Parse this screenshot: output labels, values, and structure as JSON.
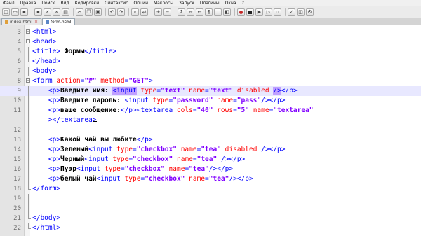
{
  "menu": [
    "Файл",
    "Правка",
    "Поиск",
    "Вид",
    "Кодировки",
    "Синтаксис",
    "Опции",
    "Макросы",
    "Запуск",
    "Плагины",
    "Окна",
    "?"
  ],
  "tabs": [
    {
      "label": "index.html",
      "active": false
    },
    {
      "label": "form.html",
      "active": true
    }
  ],
  "editor": {
    "current_line": 9,
    "lines": [
      {
        "n": "3",
        "fold": "box",
        "tokens": [
          [
            "t",
            "<html>"
          ]
        ]
      },
      {
        "n": "4",
        "fold": "box",
        "tokens": [
          [
            "t",
            "<head>"
          ]
        ]
      },
      {
        "n": "5",
        "fold": "vl",
        "tokens": [
          [
            "t",
            "<title>"
          ],
          [
            "x",
            " Формы"
          ],
          [
            "t",
            "</title>"
          ]
        ]
      },
      {
        "n": "6",
        "fold": "end",
        "tokens": [
          [
            "t",
            "</head>"
          ]
        ]
      },
      {
        "n": "7",
        "fold": "vl",
        "tokens": [
          [
            "t",
            "<body>"
          ]
        ]
      },
      {
        "n": "8",
        "fold": "box",
        "tokens": [
          [
            "t",
            "<form "
          ],
          [
            "a",
            "action"
          ],
          [
            "t",
            "="
          ],
          [
            "v",
            "\"#\""
          ],
          [
            "t",
            " "
          ],
          [
            "a",
            "method"
          ],
          [
            "t",
            "="
          ],
          [
            "v",
            "\"GET\""
          ],
          [
            "t",
            ">"
          ]
        ]
      },
      {
        "n": "9",
        "fold": "vl",
        "tokens": [
          [
            "t",
            "    <p>"
          ],
          [
            "x",
            "Введите имя: "
          ],
          [
            "th",
            "<input"
          ],
          [
            "t",
            " "
          ],
          [
            "a",
            "type"
          ],
          [
            "t",
            "="
          ],
          [
            "v",
            "\"text\""
          ],
          [
            "t",
            " "
          ],
          [
            "a",
            "name"
          ],
          [
            "t",
            "="
          ],
          [
            "v",
            "\"text\""
          ],
          [
            "t",
            " "
          ],
          [
            "a",
            "disabled"
          ],
          [
            "t",
            " "
          ],
          [
            "th",
            "/>"
          ],
          [
            "t",
            "</p>"
          ]
        ]
      },
      {
        "n": "10",
        "fold": "vl",
        "tokens": [
          [
            "t",
            "    <p>"
          ],
          [
            "x",
            "Введите пароль: "
          ],
          [
            "t",
            "<input "
          ],
          [
            "a",
            "type"
          ],
          [
            "t",
            "="
          ],
          [
            "v",
            "\"password\""
          ],
          [
            "t",
            " "
          ],
          [
            "a",
            "name"
          ],
          [
            "t",
            "="
          ],
          [
            "v",
            "\"pass\""
          ],
          [
            "t",
            "/></p>"
          ]
        ]
      },
      {
        "n": "11",
        "fold": "vl",
        "tokens": [
          [
            "t",
            "    <p>"
          ],
          [
            "x",
            "ваше сообщение:"
          ],
          [
            "t",
            "</p><textarea "
          ],
          [
            "a",
            "cols"
          ],
          [
            "t",
            "="
          ],
          [
            "v",
            "\"40\""
          ],
          [
            "t",
            " "
          ],
          [
            "a",
            "rows"
          ],
          [
            "t",
            "="
          ],
          [
            "v",
            "\"5\""
          ],
          [
            "t",
            " "
          ],
          [
            "a",
            "name"
          ],
          [
            "t",
            "="
          ],
          [
            "v",
            "\"textarea\""
          ]
        ]
      },
      {
        "n": "",
        "fold": "vl",
        "tokens": [
          [
            "t",
            "    ></textarea>"
          ]
        ]
      },
      {
        "n": "12",
        "fold": "vl",
        "tokens": []
      },
      {
        "n": "13",
        "fold": "vl",
        "tokens": [
          [
            "t",
            "    <p>"
          ],
          [
            "x",
            "Какой чай вы любите"
          ],
          [
            "t",
            "</p>"
          ]
        ]
      },
      {
        "n": "14",
        "fold": "vl",
        "tokens": [
          [
            "t",
            "    <p>"
          ],
          [
            "x",
            "Зеленый"
          ],
          [
            "t",
            "<input "
          ],
          [
            "a",
            "type"
          ],
          [
            "t",
            "="
          ],
          [
            "v",
            "\"checkbox\""
          ],
          [
            "t",
            " "
          ],
          [
            "a",
            "name"
          ],
          [
            "t",
            "="
          ],
          [
            "v",
            "\"tea\""
          ],
          [
            "t",
            " "
          ],
          [
            "a",
            "disabled"
          ],
          [
            "t",
            " /></p>"
          ]
        ]
      },
      {
        "n": "15",
        "fold": "vl",
        "tokens": [
          [
            "t",
            "    <p>"
          ],
          [
            "x",
            "Черный"
          ],
          [
            "t",
            "<input "
          ],
          [
            "a",
            "type"
          ],
          [
            "t",
            "="
          ],
          [
            "v",
            "\"checkbox\""
          ],
          [
            "t",
            " "
          ],
          [
            "a",
            "name"
          ],
          [
            "t",
            "="
          ],
          [
            "v",
            "\"tea\""
          ],
          [
            "t",
            " /></p>"
          ]
        ]
      },
      {
        "n": "16",
        "fold": "vl",
        "tokens": [
          [
            "t",
            "    <p>"
          ],
          [
            "x",
            "Пуэр"
          ],
          [
            "t",
            "<input "
          ],
          [
            "a",
            "type"
          ],
          [
            "t",
            "="
          ],
          [
            "v",
            "\"checkbox\""
          ],
          [
            "t",
            " "
          ],
          [
            "a",
            "name"
          ],
          [
            "t",
            "="
          ],
          [
            "v",
            "\"tea\""
          ],
          [
            "t",
            "/></p>"
          ]
        ]
      },
      {
        "n": "17",
        "fold": "vl",
        "tokens": [
          [
            "t",
            "    <p>"
          ],
          [
            "x",
            "белый чай"
          ],
          [
            "t",
            "<input "
          ],
          [
            "a",
            "type"
          ],
          [
            "t",
            "="
          ],
          [
            "v",
            "\"checkbox\""
          ],
          [
            "t",
            " "
          ],
          [
            "a",
            "name"
          ],
          [
            "t",
            "="
          ],
          [
            "v",
            "\"tea\""
          ],
          [
            "t",
            "/></p>"
          ]
        ]
      },
      {
        "n": "18",
        "fold": "end",
        "tokens": [
          [
            "t",
            "</form>"
          ]
        ]
      },
      {
        "n": "19",
        "fold": "vl",
        "tokens": []
      },
      {
        "n": "20",
        "fold": "vl",
        "tokens": []
      },
      {
        "n": "21",
        "fold": "end",
        "tokens": [
          [
            "t",
            "</body>"
          ]
        ]
      },
      {
        "n": "22",
        "fold": "end",
        "tokens": [
          [
            "t",
            "</html>"
          ]
        ]
      }
    ]
  },
  "icons": [
    "new-icon",
    "open-icon",
    "save-icon",
    "save-all-icon",
    "close-icon",
    "close-all-icon",
    "print-icon",
    "cut-icon",
    "copy-icon",
    "paste-icon",
    "undo-icon",
    "redo-icon",
    "find-icon",
    "replace-icon",
    "zoom-in-icon",
    "zoom-out-icon",
    "sync-v-icon",
    "sync-h-icon",
    "wrap-icon",
    "show-all-icon",
    "indent-guide-icon",
    "udl-icon",
    "record-icon",
    "stop-icon",
    "play-icon",
    "play-multi-icon",
    "save-macro-icon",
    "spell-icon",
    "preview-icon",
    "run-icon"
  ]
}
